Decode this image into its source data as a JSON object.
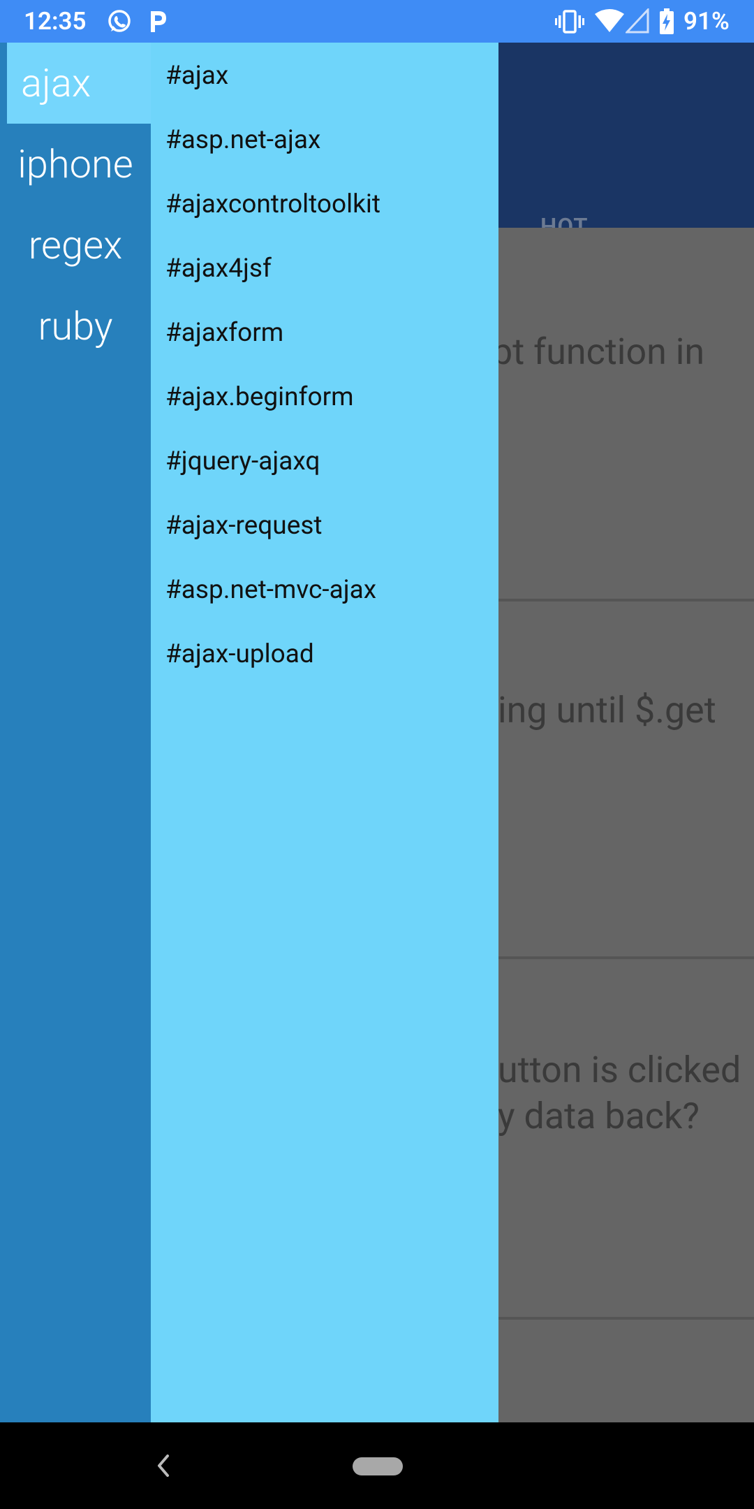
{
  "status_bar": {
    "time": "12:35",
    "battery": "91%",
    "icons": [
      "whatsapp-icon",
      "p-app-icon",
      "vibrate-icon",
      "wifi-icon",
      "no-signal-icon",
      "battery-charging-icon"
    ]
  },
  "app": {
    "tabs": {
      "hot_label": "HOT"
    },
    "cards": [
      {
        "partial_title_lines": [
          "pt function in"
        ]
      },
      {
        "partial_title_lines": [
          "ing until $.get"
        ]
      },
      {
        "partial_title_lines": [
          "utton is clicked",
          "y data back?"
        ]
      }
    ]
  },
  "drawer": {
    "categories": [
      {
        "label": "ajax",
        "selected": true
      },
      {
        "label": "iphone",
        "selected": false
      },
      {
        "label": "regex",
        "selected": false
      },
      {
        "label": "ruby",
        "selected": false
      }
    ],
    "tags": [
      "#ajax",
      "#asp.net-ajax",
      "#ajaxcontroltoolkit",
      "#ajax4jsf",
      "#ajaxform",
      "#ajax.beginform",
      "#jquery-ajaxq",
      "#ajax-request",
      "#asp.net-mvc-ajax",
      "#ajax-upload"
    ]
  },
  "colors": {
    "status_bar": "#3f8cf5",
    "app_header": "#1a3564",
    "drawer_categories": "#2780bc",
    "drawer_tags": "#6fd5fa",
    "category_selected": "#75d6fc"
  },
  "nav_bar": {
    "icons": [
      "back-icon",
      "home-pill-icon"
    ]
  }
}
